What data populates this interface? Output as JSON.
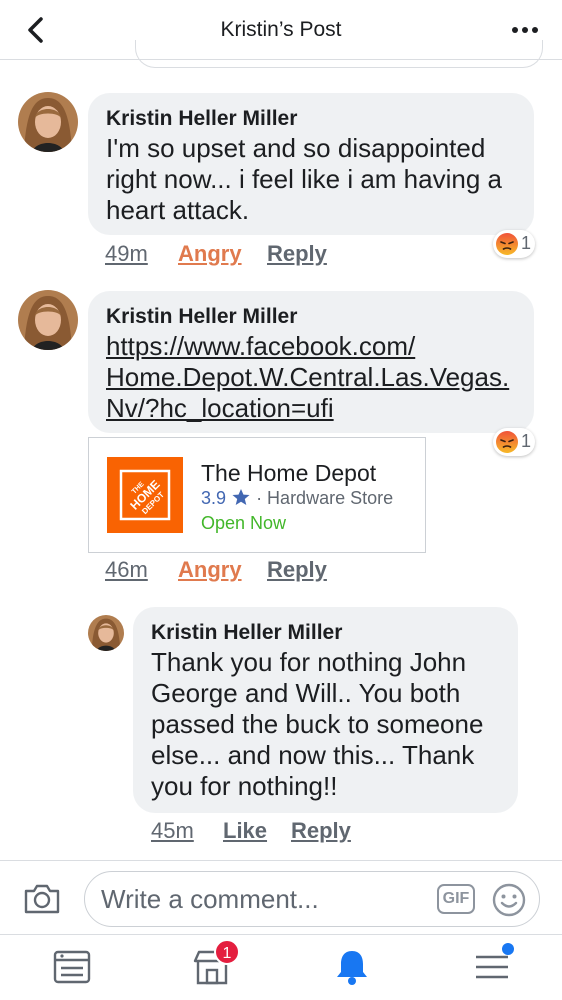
{
  "header": {
    "title": "Kristin’s Post"
  },
  "comments": [
    {
      "author": "Kristin Heller Miller",
      "text_lines": [
        "I'm so upset and so disappointed",
        "right now... i feel like i am having a",
        "heart attack."
      ],
      "time": "49m",
      "reaction_label": "Angry",
      "reply_label": "Reply",
      "reaction_count": "1"
    },
    {
      "author": "Kristin Heller Miller",
      "link_lines": [
        "https://www.facebook.com/",
        "Home.Depot.W.Central.Las.Vegas.",
        "Nv/?hc_location=ufi"
      ],
      "time": "46m",
      "reaction_label": "Angry",
      "reply_label": "Reply",
      "reaction_count": "1",
      "card": {
        "title": "The Home Depot",
        "rating": "3.9",
        "category": "· Hardware Store",
        "status": "Open Now",
        "logo_color": "#f96302"
      }
    },
    {
      "author": "Kristin Heller Miller",
      "text_lines": [
        "Thank you for nothing John",
        "George and Will.. You both",
        "passed the buck to someone",
        "else... and now this... Thank",
        "you for nothing!!"
      ],
      "time": "45m",
      "like_label": "Like",
      "reply_label": "Reply"
    }
  ],
  "composer": {
    "placeholder": "Write a comment...",
    "gif_label": "GIF"
  },
  "nav": {
    "marketplace_badge": "1"
  },
  "colors": {
    "angry": "#e07a4e",
    "link_blue": "#4267b2",
    "open_green": "#42b72a",
    "badge_red": "#e41e3f",
    "active_blue": "#1877f2"
  }
}
